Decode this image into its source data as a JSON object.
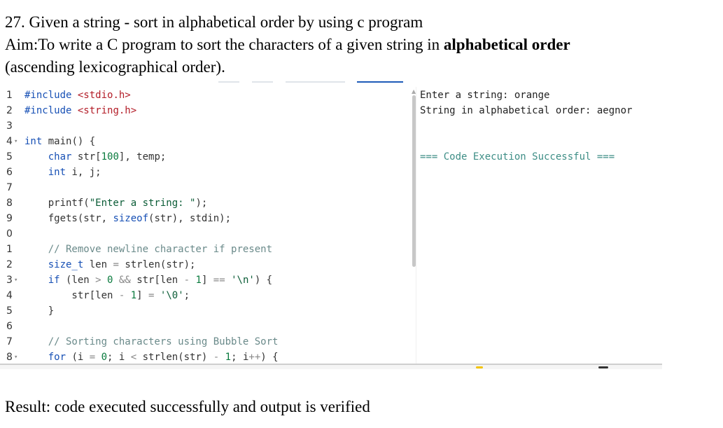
{
  "title": "27. Given a string - sort in alphabetical order by using c program",
  "aim": {
    "prefix": "Aim:To write a C program to sort the characters of a given string in ",
    "bold": "alphabetical order",
    "line2": "(ascending lexicographical order)."
  },
  "result": "Result: code executed successfully and output is verified",
  "editor": {
    "line_numbers": [
      "1",
      "2",
      "3",
      "4",
      "5",
      "6",
      "7",
      "8",
      "9",
      "0",
      "1",
      "2",
      "3",
      "4",
      "5",
      "6",
      "7",
      "8"
    ],
    "fold_markers": [
      "",
      "",
      "",
      "▾",
      "",
      "",
      "",
      "",
      "",
      "",
      "",
      "",
      "▾",
      "",
      "",
      "",
      "",
      "▾"
    ],
    "lines": [
      "#include <stdio.h>",
      "#include <string.h>",
      "",
      "int main() {",
      "    char str[100], temp;",
      "    int i, j;",
      "",
      "    printf(\"Enter a string: \");",
      "    fgets(str, sizeof(str), stdin);",
      "",
      "    // Remove newline character if present",
      "    size_t len = strlen(str);",
      "    if (len > 0 && str[len - 1] == '\\n') {",
      "        str[len - 1] = '\\0';",
      "    }",
      "",
      "    // Sorting characters using Bubble Sort",
      "    for (i = 0; i < strlen(str) - 1; i++) {"
    ]
  },
  "output": {
    "lines": [
      "Enter a string: orange",
      "String in alphabetical order: aegnor",
      "",
      "",
      "=== Code Execution Successful ==="
    ]
  },
  "colors": {
    "keyword": "#1750b5",
    "include": "#b31d28",
    "string": "#0a5c36",
    "comment": "#6a8a8a",
    "success": "#3e8e86",
    "active_tab": "#1e5bb8"
  }
}
